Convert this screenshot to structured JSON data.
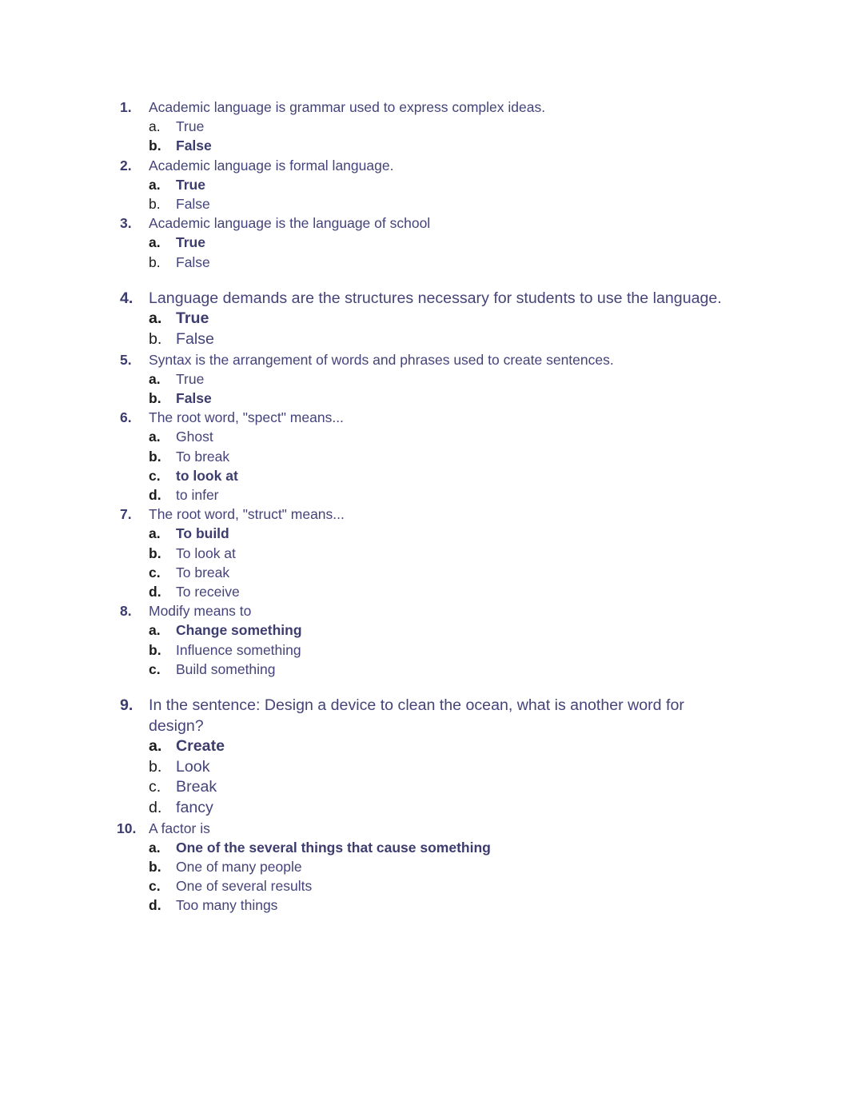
{
  "document": {
    "text_color": "#44447a",
    "marker_color": "#1b1b1b",
    "background": "#ffffff",
    "questions": [
      {
        "number": "1.",
        "text": "Academic language is grammar used to express complex ideas.",
        "size": "normal",
        "gap_before": false,
        "options": [
          {
            "marker": "a.",
            "label": "True",
            "bold": false,
            "marker_bold": false
          },
          {
            "marker": "b.",
            "label": "False",
            "bold": true,
            "marker_bold": true
          }
        ]
      },
      {
        "number": "2.",
        "text": "Academic language is formal language.",
        "size": "normal",
        "gap_before": false,
        "options": [
          {
            "marker": "a.",
            "label": "True",
            "bold": true,
            "marker_bold": true
          },
          {
            "marker": "b.",
            "label": "False",
            "bold": false,
            "marker_bold": false
          }
        ]
      },
      {
        "number": "3.",
        "text": "Academic language is the language of school",
        "size": "normal",
        "gap_before": false,
        "options": [
          {
            "marker": "a.",
            "label": "True",
            "bold": true,
            "marker_bold": true
          },
          {
            "marker": "b.",
            "label": "False",
            "bold": false,
            "marker_bold": false
          }
        ]
      },
      {
        "number": "4.",
        "text": "Language demands are the structures necessary for students to use the language.",
        "size": "large",
        "gap_before": true,
        "options": [
          {
            "marker": "a.",
            "label": "True",
            "bold": true,
            "marker_bold": true
          },
          {
            "marker": "b.",
            "label": "False",
            "bold": false,
            "marker_bold": false
          }
        ]
      },
      {
        "number": "5.",
        "text": "Syntax is the arrangement of words and phrases used to create sentences.",
        "size": "normal",
        "gap_before": false,
        "options": [
          {
            "marker": "a.",
            "label": "True",
            "bold": false,
            "marker_bold": true
          },
          {
            "marker": "b.",
            "label": "False",
            "bold": true,
            "marker_bold": true
          }
        ]
      },
      {
        "number": "6.",
        "text": "The root word, \"spect\" means...",
        "size": "normal",
        "gap_before": false,
        "options": [
          {
            "marker": "a.",
            "label": "Ghost",
            "bold": false,
            "marker_bold": true
          },
          {
            "marker": "b.",
            "label": "To break",
            "bold": false,
            "marker_bold": true
          },
          {
            "marker": "c.",
            "label": "to look at",
            "bold": true,
            "marker_bold": true
          },
          {
            "marker": "d.",
            "label": "to infer",
            "bold": false,
            "marker_bold": true
          }
        ]
      },
      {
        "number": "7.",
        "text": "The root word, \"struct\" means...",
        "size": "normal",
        "gap_before": false,
        "options": [
          {
            "marker": "a.",
            "label": "To build",
            "bold": true,
            "marker_bold": true
          },
          {
            "marker": "b.",
            "label": "To look at",
            "bold": false,
            "marker_bold": true
          },
          {
            "marker": "c.",
            "label": "To break",
            "bold": false,
            "marker_bold": true
          },
          {
            "marker": "d.",
            "label": "To receive",
            "bold": false,
            "marker_bold": true
          }
        ]
      },
      {
        "number": "8.",
        "text": "Modify means to",
        "size": "normal",
        "gap_before": false,
        "options": [
          {
            "marker": "a.",
            "label": "Change something",
            "bold": true,
            "marker_bold": true
          },
          {
            "marker": "b.",
            "label": "Influence something",
            "bold": false,
            "marker_bold": true
          },
          {
            "marker": "c.",
            "label": "Build something",
            "bold": false,
            "marker_bold": true
          }
        ]
      },
      {
        "number": "9.",
        "text": " In the sentence: Design a device to clean the ocean, what is another word for design?",
        "size": "large",
        "gap_before": true,
        "options": [
          {
            "marker": "a.",
            "label": "Create",
            "bold": true,
            "marker_bold": true
          },
          {
            "marker": "b.",
            "label": "Look",
            "bold": false,
            "marker_bold": false
          },
          {
            "marker": "c.",
            "label": "Break",
            "bold": false,
            "marker_bold": false
          },
          {
            "marker": "d.",
            "label": "fancy",
            "bold": false,
            "marker_bold": false
          }
        ]
      },
      {
        "number": "10.",
        "text": "A factor is",
        "size": "normal",
        "gap_before": false,
        "wide_number": true,
        "options": [
          {
            "marker": "a.",
            "label": "One of the several things that cause something",
            "bold": true,
            "marker_bold": true
          },
          {
            "marker": "b.",
            "label": "One of many people",
            "bold": false,
            "marker_bold": true
          },
          {
            "marker": "c.",
            "label": "One of several results",
            "bold": false,
            "marker_bold": true
          },
          {
            "marker": "d.",
            "label": "Too many things",
            "bold": false,
            "marker_bold": true
          }
        ]
      }
    ]
  }
}
